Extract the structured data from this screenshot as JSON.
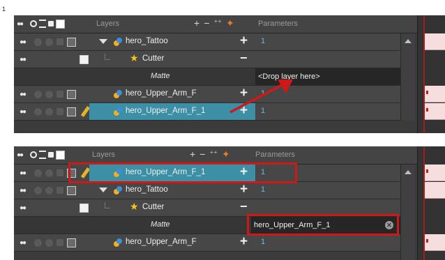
{
  "step_number": "1",
  "panels": [
    {
      "header": {
        "layers_label": "Layers",
        "parameters_label": "Parameters"
      },
      "rows": [
        {
          "name": "hero_Tattoo",
          "param": "1",
          "type": "group"
        },
        {
          "name": "Cutter",
          "param": "",
          "type": "cutter"
        },
        {
          "name": "Matte",
          "param": "<Drop layer here>",
          "type": "matte"
        },
        {
          "name": "hero_Upper_Arm_F",
          "param": "1",
          "type": "layer"
        },
        {
          "name": "hero_Upper_Arm_F_1",
          "param": "1",
          "type": "layer-selected"
        }
      ]
    },
    {
      "header": {
        "layers_label": "Layers",
        "parameters_label": "Parameters"
      },
      "rows": [
        {
          "name": "hero_Upper_Arm_F_1",
          "param": "1",
          "type": "layer-selected"
        },
        {
          "name": "hero_Tattoo",
          "param": "1",
          "type": "group"
        },
        {
          "name": "Cutter",
          "param": "",
          "type": "cutter"
        },
        {
          "name": "Matte",
          "param": "hero_Upper_Arm_F_1",
          "type": "matte"
        },
        {
          "name": "hero_Upper_Arm_F",
          "param": "1",
          "type": "layer"
        }
      ]
    }
  ],
  "colors": {
    "highlight": "#d11818",
    "selected_row": "#3c8fa5",
    "param_text": "#5fc0e6",
    "timeline_cell": "#f7dede"
  },
  "icons": {
    "layer": "drawing-layer-icon",
    "cutter": "star-icon",
    "add": "plus-icon",
    "remove": "minus-icon",
    "clear": "clear-icon"
  }
}
